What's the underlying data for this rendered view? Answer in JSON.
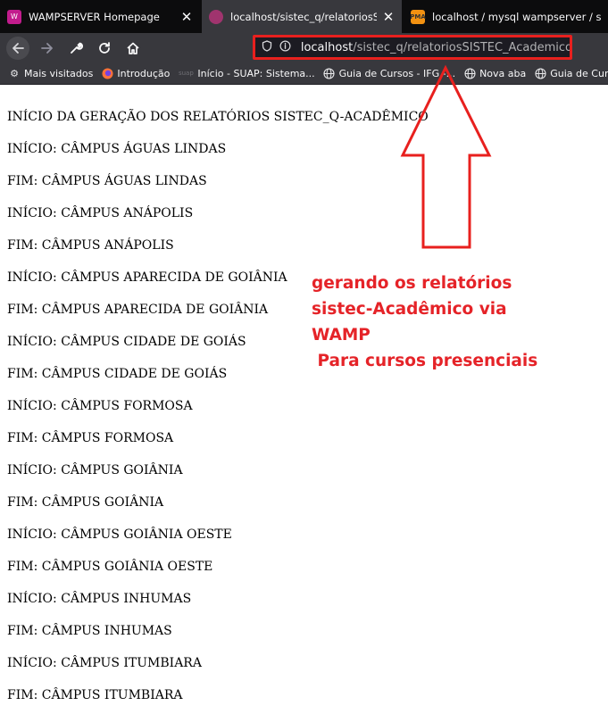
{
  "tabs": [
    {
      "title": "WAMPSERVER Homepage",
      "favicon": "wamp-icon",
      "favicon_color": "#c21c8d",
      "active": false
    },
    {
      "title": "localhost/sistec_q/relatoriosSISTEC",
      "favicon": "wamp-icon",
      "favicon_color": "#a0346e",
      "active": true
    },
    {
      "title": "localhost / mysql wampserver / sis",
      "favicon": "phpmyadmin-icon",
      "favicon_color": "#f29111",
      "active": false
    }
  ],
  "nav": {
    "url_host": "localhost",
    "url_path": "/sistec_q/relatoriosSISTEC_Academico.php"
  },
  "bookmarks": [
    {
      "label": "Mais visitados",
      "icon": "gear-icon"
    },
    {
      "label": "Introdução",
      "icon": "firefox-icon"
    },
    {
      "label": "Início - SUAP: Sistema...",
      "icon": "suap-icon"
    },
    {
      "label": "Guia de Cursos - IFG -...",
      "icon": "globe-icon"
    },
    {
      "label": "Nova aba",
      "icon": "globe-icon"
    },
    {
      "label": "Guia de Cursos",
      "icon": "globe-icon"
    }
  ],
  "content": {
    "lines": [
      "INÍCIO DA GERAÇÃO DOS RELATÓRIOS SISTEC_Q-ACADÊMICO",
      "INÍCIO: CÂMPUS ÁGUAS LINDAS",
      "FIM: CÂMPUS ÁGUAS LINDAS",
      "INÍCIO: CÂMPUS ANÁPOLIS",
      "FIM: CÂMPUS ANÁPOLIS",
      "INÍCIO: CÂMPUS APARECIDA DE GOIÂNIA",
      "FIM: CÂMPUS APARECIDA DE GOIÂNIA",
      "INÍCIO: CÂMPUS CIDADE DE GOIÁS",
      "FIM: CÂMPUS CIDADE DE GOIÁS",
      "INÍCIO: CÂMPUS FORMOSA",
      "FIM: CÂMPUS FORMOSA",
      "INÍCIO: CÂMPUS GOIÂNIA",
      "FIM: CÂMPUS GOIÂNIA",
      "INÍCIO: CÂMPUS GOIÂNIA OESTE",
      "FIM: CÂMPUS GOIÂNIA OESTE",
      "INÍCIO: CÂMPUS INHUMAS",
      "FIM: CÂMPUS INHUMAS",
      "INÍCIO: CÂMPUS ITUMBIARA",
      "FIM: CÂMPUS ITUMBIARA"
    ]
  },
  "annotation": {
    "lines": [
      "gerando os relatórios",
      "sistec-Acadêmico via",
      "WAMP",
      " Para cursos presenciais"
    ],
    "color": "#e52328"
  }
}
